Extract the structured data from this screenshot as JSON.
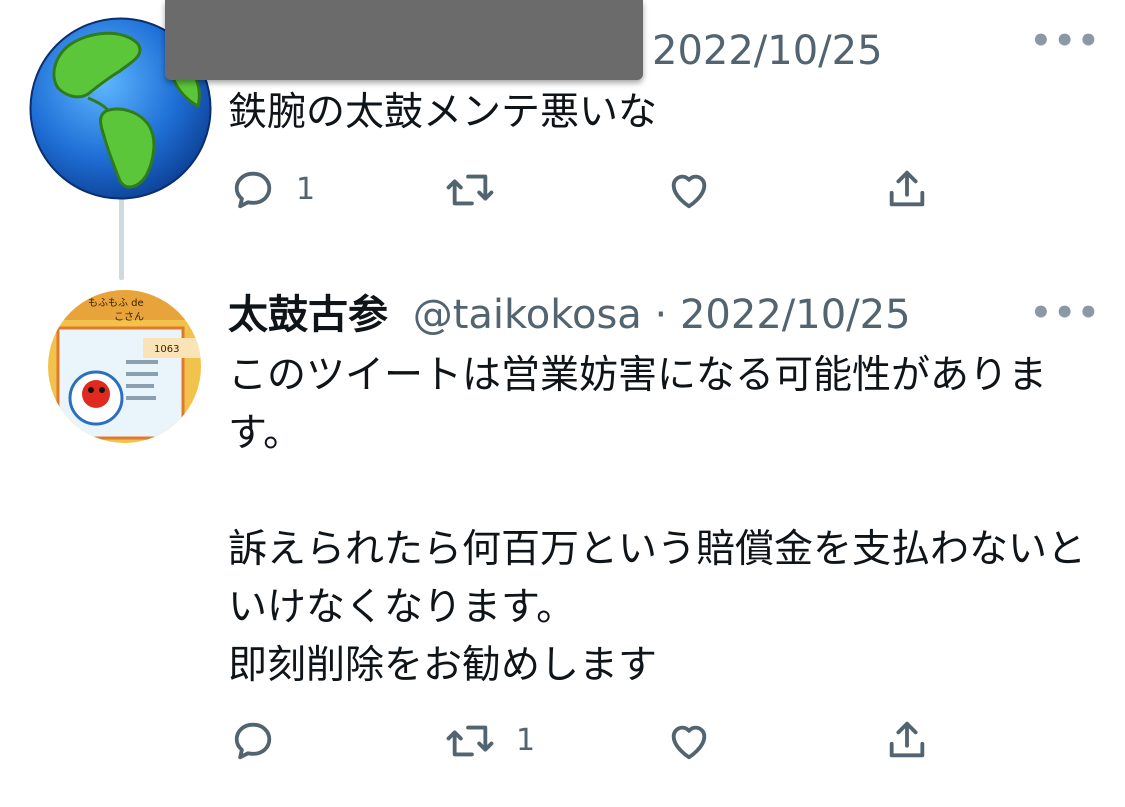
{
  "tweets": [
    {
      "date": "2022/10/25",
      "more_label": "•••",
      "text": "鉄腕の太鼓メンテ悪いな",
      "actions": {
        "reply_count": "1",
        "retweet_count": "",
        "like_count": ""
      }
    },
    {
      "name": "太鼓古参",
      "handle": "@taikokosa",
      "separator": " · ",
      "date": "2022/10/25",
      "more_label": "•••",
      "text": "このツイートは営業妨害になる可能性があります。\n\n訴えられたら何百万という賠償金を支払わないといけなくなります。\n即刻削除をお勧めします",
      "actions": {
        "reply_count": "",
        "retweet_count": "1",
        "like_count": ""
      }
    }
  ],
  "avatar2_card": {
    "title": "もふもふ de",
    "subtitle": "こさん",
    "badge": "1063"
  },
  "colors": {
    "text": "#0f1419",
    "muted": "#536471",
    "icon": "#536471",
    "thread_line": "#cfd9de"
  },
  "icons": [
    "reply-icon",
    "retweet-icon",
    "like-icon",
    "share-icon",
    "more-icon"
  ]
}
